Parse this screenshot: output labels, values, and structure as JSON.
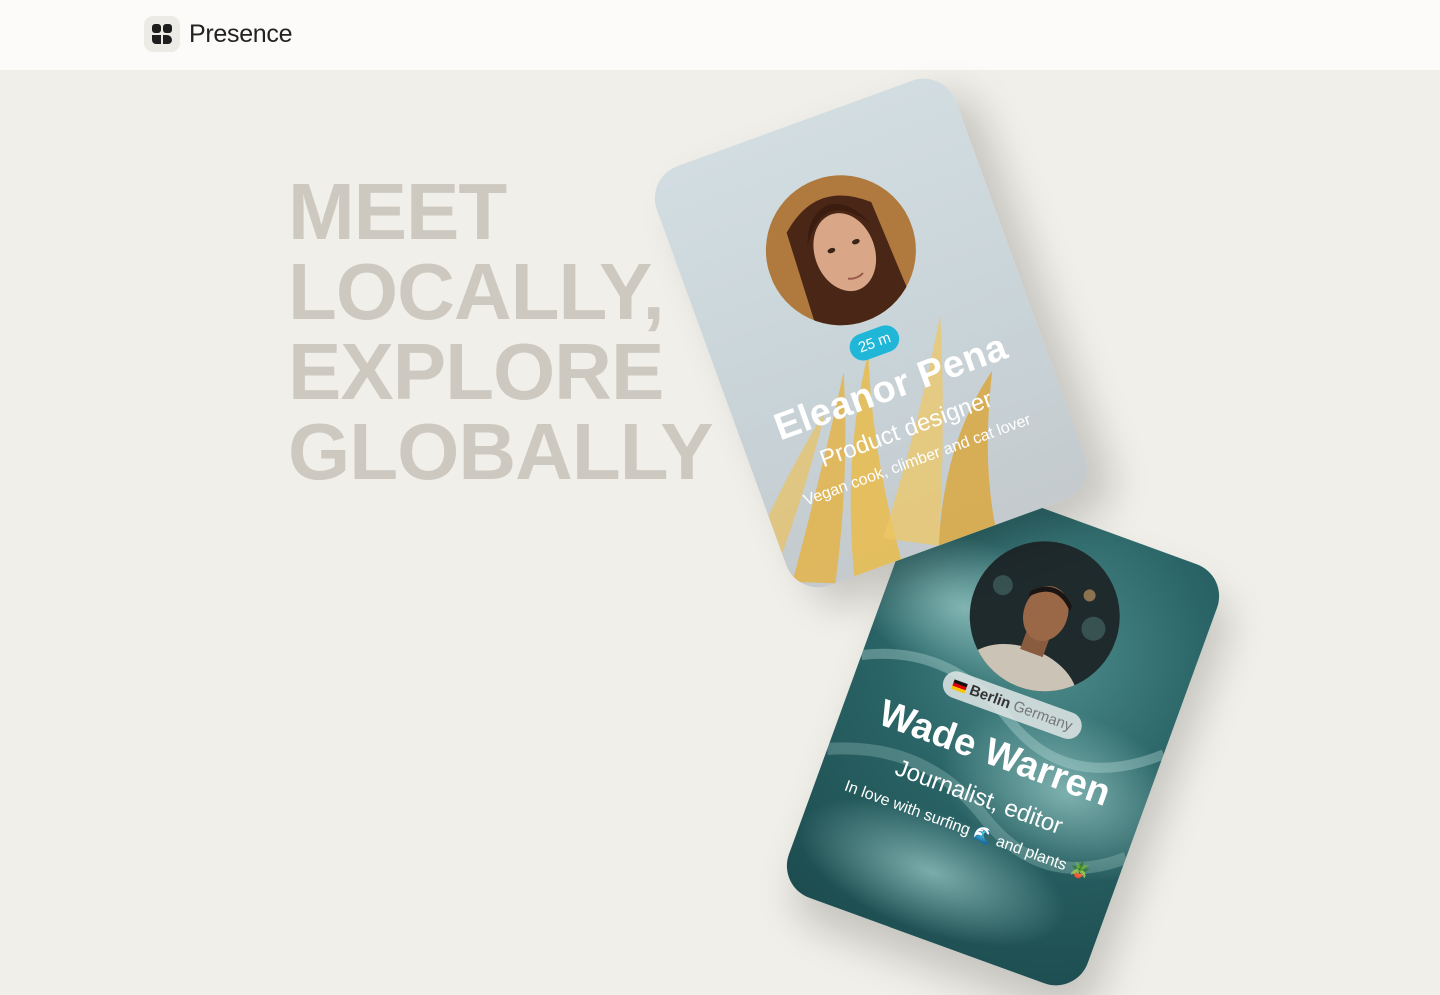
{
  "header": {
    "brand_name": "Presence",
    "logo_icon": "presence-logo-icon"
  },
  "hero": {
    "lines": [
      "MEET",
      "LOCALLY,",
      "EXPLORE",
      "GLOBALLY"
    ]
  },
  "cards": [
    {
      "distance": "25 m",
      "name": "Eleanor Pena",
      "title": "Product designer",
      "bio": "Vegan cook, climber and cat lover"
    },
    {
      "location_city": "Berlin",
      "location_country": "Germany",
      "name": "Wade Warren",
      "title": "Journalist, editor",
      "bio": "In love with surfing 🌊 and plants 🪴"
    }
  ],
  "colors": {
    "accent_pill": "#1fb6d8",
    "hero_text": "#cdc9c1",
    "background": "#f1efe9"
  }
}
